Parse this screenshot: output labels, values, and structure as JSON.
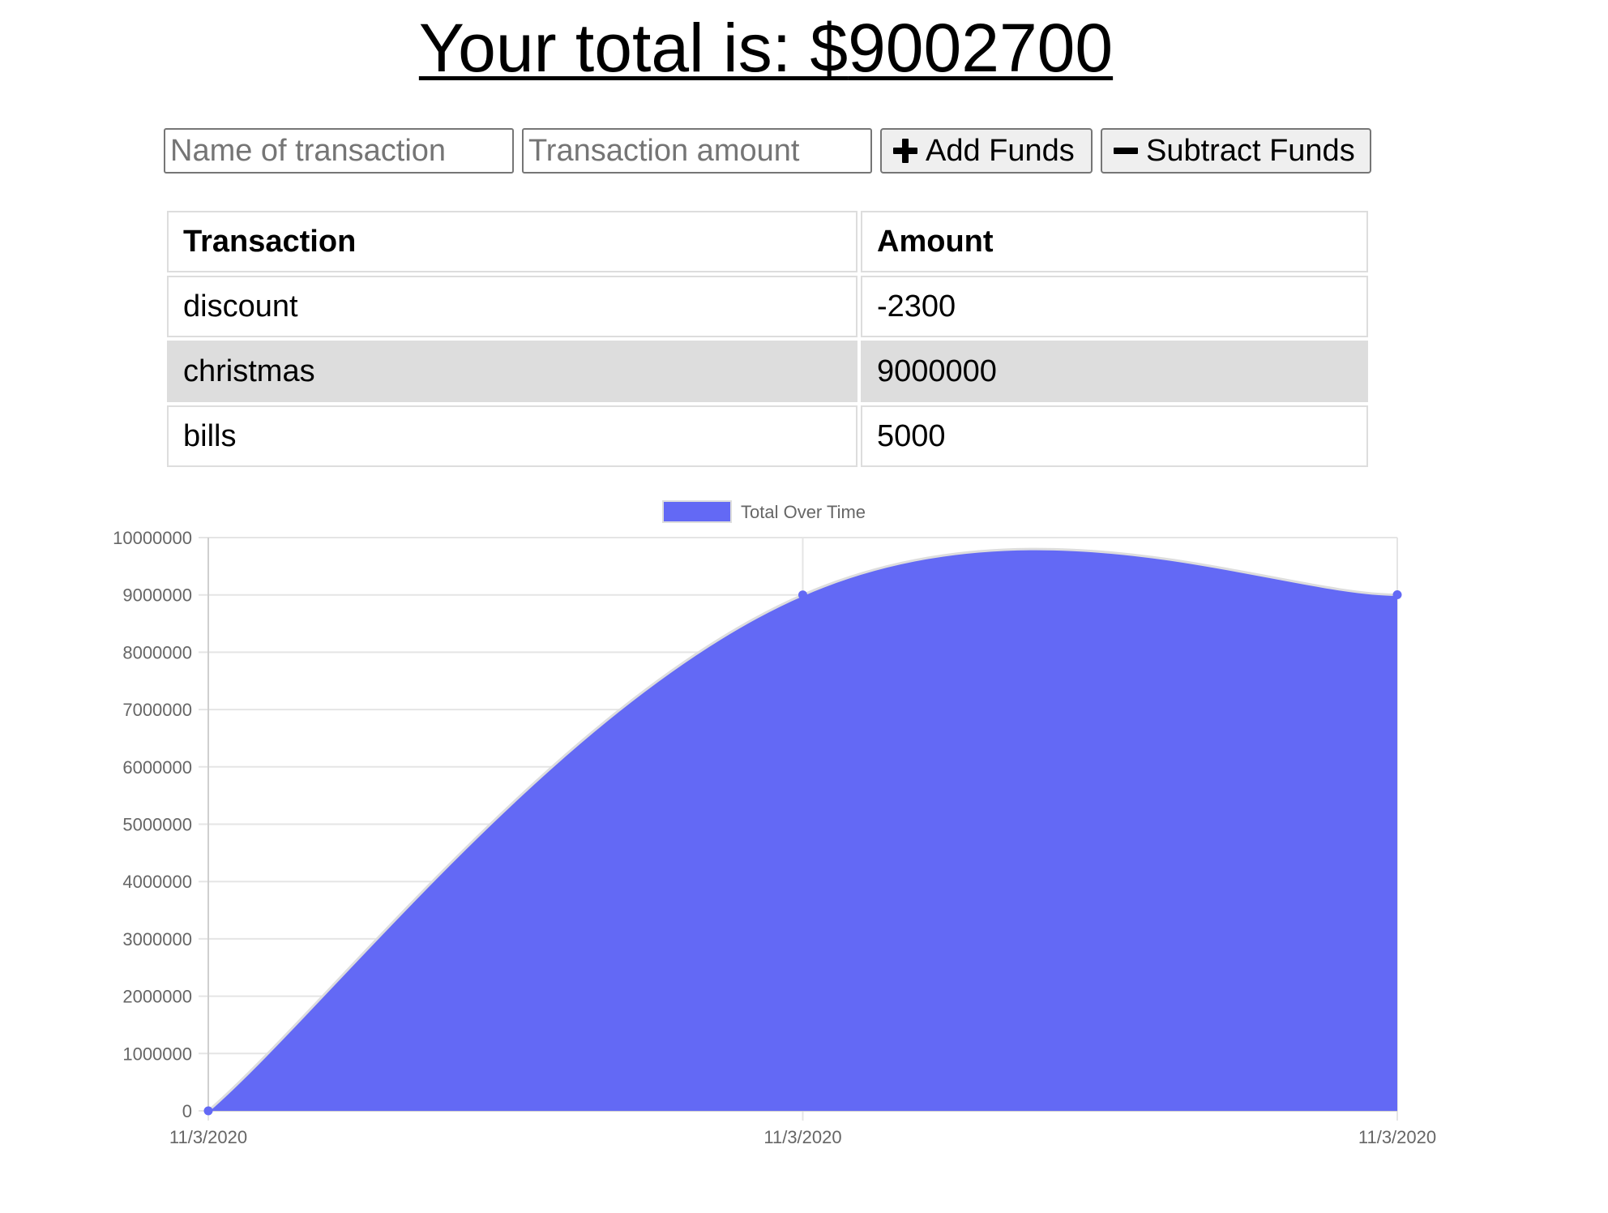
{
  "header": {
    "total_label": "Your total is: $",
    "total_value": "9002700"
  },
  "form": {
    "name_placeholder": "Name of transaction",
    "amount_placeholder": "Transaction amount",
    "add_label": "Add Funds",
    "add_icon": "plus-icon",
    "subtract_label": "Subtract Funds",
    "subtract_icon": "minus-icon"
  },
  "table": {
    "headers": [
      "Transaction",
      "Amount"
    ],
    "rows": [
      {
        "name": "discount",
        "amount": "-2300"
      },
      {
        "name": "christmas",
        "amount": "9000000"
      },
      {
        "name": "bills",
        "amount": "5000"
      }
    ]
  },
  "chart_data": {
    "type": "area",
    "title": "",
    "legend": [
      "Total Over Time"
    ],
    "legend_position": "top",
    "x": [
      "11/3/2020",
      "11/3/2020",
      "11/3/2020"
    ],
    "series": [
      {
        "name": "Total Over Time",
        "values": [
          0,
          9000000,
          9002700
        ]
      }
    ],
    "xlabel": "",
    "ylabel": "",
    "ylim": [
      0,
      10000000
    ],
    "y_ticks": [
      0,
      1000000,
      2000000,
      3000000,
      4000000,
      5000000,
      6000000,
      7000000,
      8000000,
      9000000,
      10000000
    ],
    "grid": true,
    "colors": {
      "fill": "#6369f5",
      "line": "#dddddd",
      "point": "#6369f5"
    }
  }
}
